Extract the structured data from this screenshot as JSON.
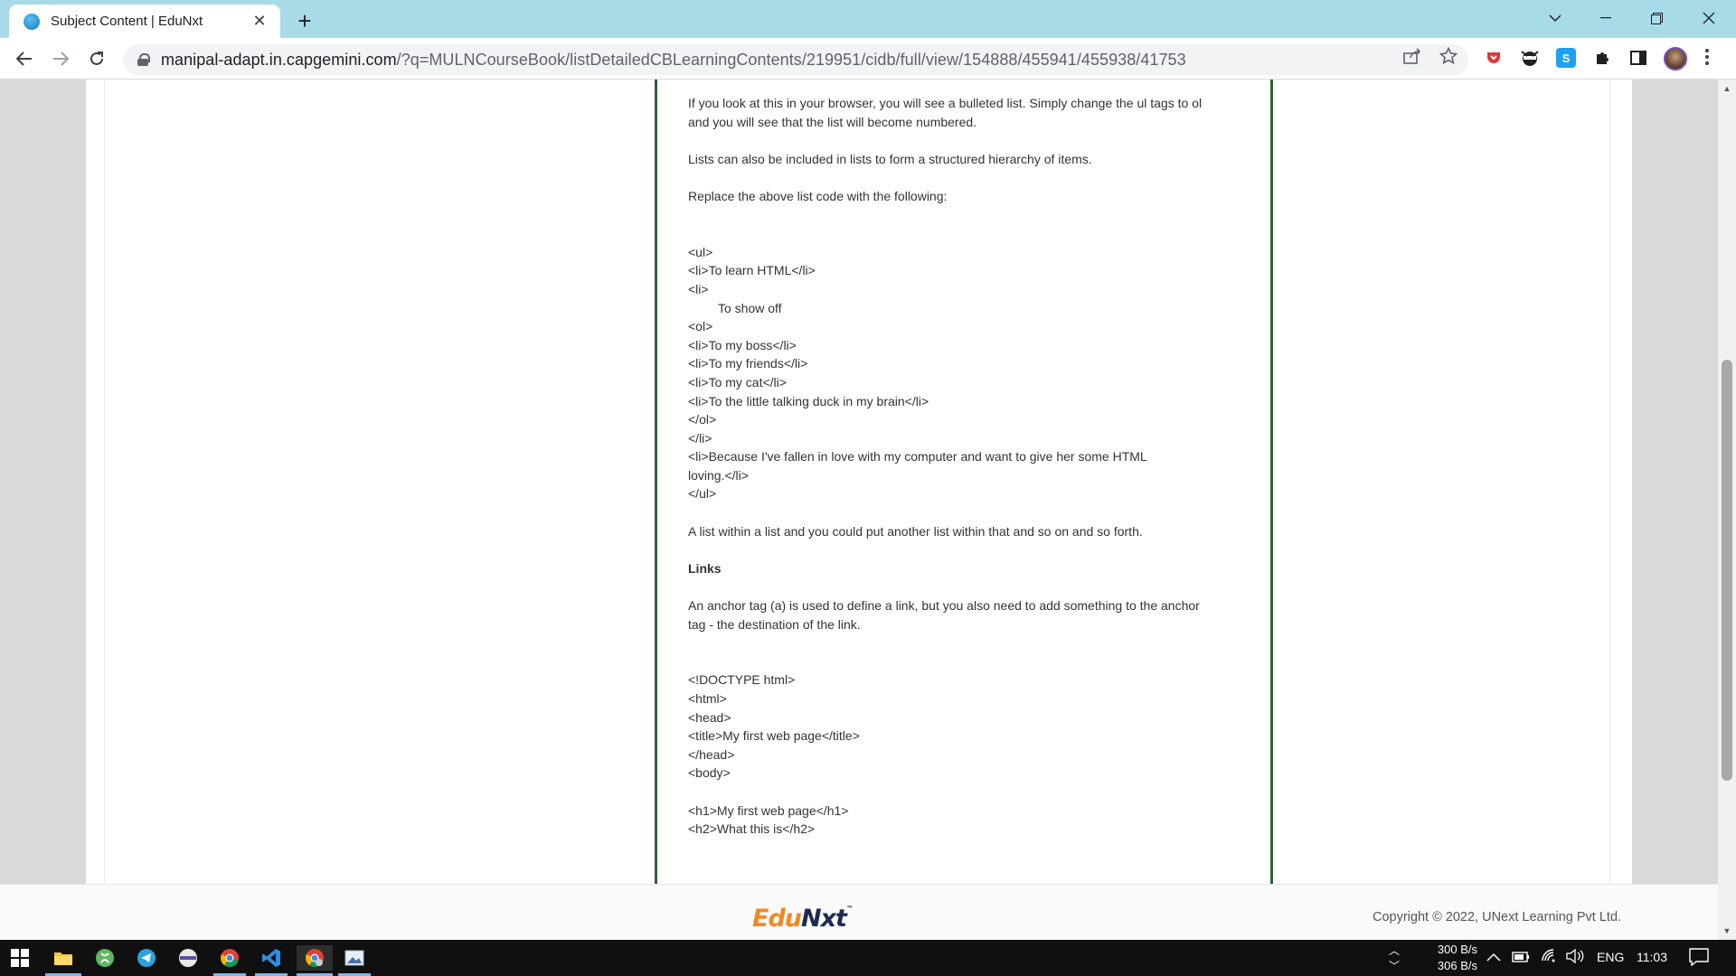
{
  "browser": {
    "tab_title": "Subject Content | EduNxt",
    "new_tab_symbol": "+",
    "url_host": "manipal-adapt.in.capgemini.com",
    "url_rest": "/?q=MULNCourseBook/listDetailedCBLearningContents/219951/cidb/full/view/154888/455941/455938/41753"
  },
  "content": {
    "p1": "If you look at this in your browser, you will see a bulleted list. Simply change the ul tags to ol\nand you will see that the list will become numbered.",
    "p2": "Lists can also be included in lists to form a structured hierarchy of items.",
    "p3": "Replace the above list code with the following:",
    "code1": [
      "<ul>",
      "<li>To learn HTML</li>",
      "<li>",
      "To show off",
      "<ol>",
      "<li>To my boss</li>",
      "<li>To my friends</li>",
      "<li>To my cat</li>",
      "<li>To the little talking duck in my brain</li>",
      "</ol>",
      "</li>",
      "<li>Because I've fallen in love with my computer and want to give her some HTML\nloving.</li>",
      "</ul>"
    ],
    "p4": "A list within a list and you could put another list within that and so on and so forth.",
    "heading_links": "Links",
    "p5": "An anchor tag (a) is used to define a link, but you also need to add something to the anchor\ntag - the destination of the link.",
    "code2": [
      "<!DOCTYPE html>",
      "<html>",
      "<head>",
      "<title>My first web page</title>",
      "</head>",
      "<body>"
    ],
    "code3": [
      "<h1>My first web page</h1>",
      "<h2>What this is</h2>"
    ]
  },
  "footer": {
    "logo_edu": "Edu",
    "logo_nxt": "Nxt",
    "logo_tm": "™",
    "copyright": "Copyright © 2022, UNext Learning Pvt Ltd."
  },
  "taskbar": {
    "net_up": "300 B/s",
    "net_down": "306 B/s",
    "language": "ENG",
    "time": "11:03"
  },
  "colors": {
    "tabstrip": "#a8dbe8",
    "content_border": "#2f5f36",
    "logo_orange": "#f08a24",
    "logo_navy": "#1d2b4f"
  }
}
